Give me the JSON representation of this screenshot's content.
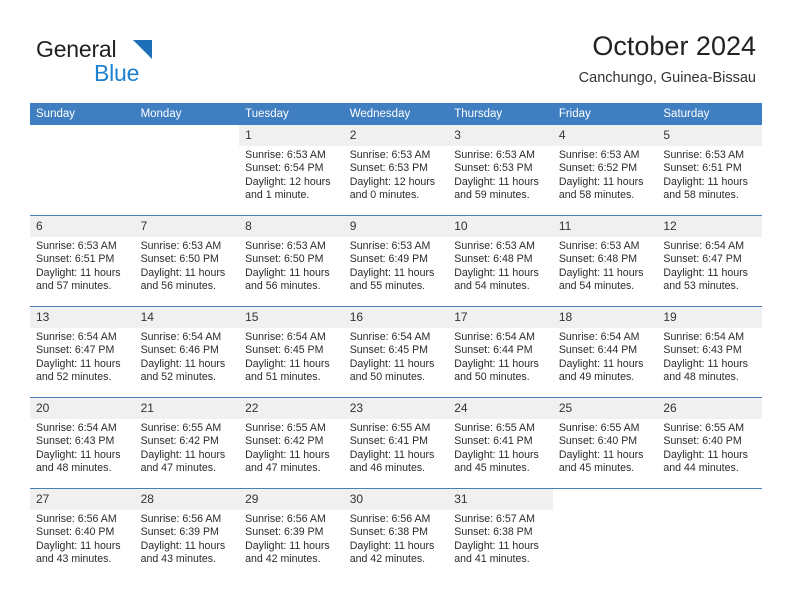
{
  "brand": {
    "line1": "General",
    "line2": "Blue",
    "triangle_color": "#1d6fb8",
    "line2_color": "#1d81d0"
  },
  "header": {
    "title": "October 2024",
    "subtitle": "Canchungo, Guinea-Bissau"
  },
  "theme": {
    "header_blue": "#3f7fc1",
    "daynum_band": "#f0f0f0",
    "grid_line": "#4a7fb5"
  },
  "weekdays": [
    "Sunday",
    "Monday",
    "Tuesday",
    "Wednesday",
    "Thursday",
    "Friday",
    "Saturday"
  ],
  "weeks": [
    [
      {
        "day": "",
        "sunrise": "",
        "sunset": "",
        "daylight1": "",
        "daylight2": "",
        "type": "blank"
      },
      {
        "day": "",
        "sunrise": "",
        "sunset": "",
        "daylight1": "",
        "daylight2": "",
        "type": "blank"
      },
      {
        "day": "1",
        "sunrise": "Sunrise: 6:53 AM",
        "sunset": "Sunset: 6:54 PM",
        "daylight1": "Daylight: 12 hours",
        "daylight2": "and 1 minute.",
        "type": "filled"
      },
      {
        "day": "2",
        "sunrise": "Sunrise: 6:53 AM",
        "sunset": "Sunset: 6:53 PM",
        "daylight1": "Daylight: 12 hours",
        "daylight2": "and 0 minutes.",
        "type": "filled"
      },
      {
        "day": "3",
        "sunrise": "Sunrise: 6:53 AM",
        "sunset": "Sunset: 6:53 PM",
        "daylight1": "Daylight: 11 hours",
        "daylight2": "and 59 minutes.",
        "type": "filled"
      },
      {
        "day": "4",
        "sunrise": "Sunrise: 6:53 AM",
        "sunset": "Sunset: 6:52 PM",
        "daylight1": "Daylight: 11 hours",
        "daylight2": "and 58 minutes.",
        "type": "filled"
      },
      {
        "day": "5",
        "sunrise": "Sunrise: 6:53 AM",
        "sunset": "Sunset: 6:51 PM",
        "daylight1": "Daylight: 11 hours",
        "daylight2": "and 58 minutes.",
        "type": "filled"
      }
    ],
    [
      {
        "day": "6",
        "sunrise": "Sunrise: 6:53 AM",
        "sunset": "Sunset: 6:51 PM",
        "daylight1": "Daylight: 11 hours",
        "daylight2": "and 57 minutes.",
        "type": "filled"
      },
      {
        "day": "7",
        "sunrise": "Sunrise: 6:53 AM",
        "sunset": "Sunset: 6:50 PM",
        "daylight1": "Daylight: 11 hours",
        "daylight2": "and 56 minutes.",
        "type": "filled"
      },
      {
        "day": "8",
        "sunrise": "Sunrise: 6:53 AM",
        "sunset": "Sunset: 6:50 PM",
        "daylight1": "Daylight: 11 hours",
        "daylight2": "and 56 minutes.",
        "type": "filled"
      },
      {
        "day": "9",
        "sunrise": "Sunrise: 6:53 AM",
        "sunset": "Sunset: 6:49 PM",
        "daylight1": "Daylight: 11 hours",
        "daylight2": "and 55 minutes.",
        "type": "filled"
      },
      {
        "day": "10",
        "sunrise": "Sunrise: 6:53 AM",
        "sunset": "Sunset: 6:48 PM",
        "daylight1": "Daylight: 11 hours",
        "daylight2": "and 54 minutes.",
        "type": "filled"
      },
      {
        "day": "11",
        "sunrise": "Sunrise: 6:53 AM",
        "sunset": "Sunset: 6:48 PM",
        "daylight1": "Daylight: 11 hours",
        "daylight2": "and 54 minutes.",
        "type": "filled"
      },
      {
        "day": "12",
        "sunrise": "Sunrise: 6:54 AM",
        "sunset": "Sunset: 6:47 PM",
        "daylight1": "Daylight: 11 hours",
        "daylight2": "and 53 minutes.",
        "type": "filled"
      }
    ],
    [
      {
        "day": "13",
        "sunrise": "Sunrise: 6:54 AM",
        "sunset": "Sunset: 6:47 PM",
        "daylight1": "Daylight: 11 hours",
        "daylight2": "and 52 minutes.",
        "type": "filled"
      },
      {
        "day": "14",
        "sunrise": "Sunrise: 6:54 AM",
        "sunset": "Sunset: 6:46 PM",
        "daylight1": "Daylight: 11 hours",
        "daylight2": "and 52 minutes.",
        "type": "filled"
      },
      {
        "day": "15",
        "sunrise": "Sunrise: 6:54 AM",
        "sunset": "Sunset: 6:45 PM",
        "daylight1": "Daylight: 11 hours",
        "daylight2": "and 51 minutes.",
        "type": "filled"
      },
      {
        "day": "16",
        "sunrise": "Sunrise: 6:54 AM",
        "sunset": "Sunset: 6:45 PM",
        "daylight1": "Daylight: 11 hours",
        "daylight2": "and 50 minutes.",
        "type": "filled"
      },
      {
        "day": "17",
        "sunrise": "Sunrise: 6:54 AM",
        "sunset": "Sunset: 6:44 PM",
        "daylight1": "Daylight: 11 hours",
        "daylight2": "and 50 minutes.",
        "type": "filled"
      },
      {
        "day": "18",
        "sunrise": "Sunrise: 6:54 AM",
        "sunset": "Sunset: 6:44 PM",
        "daylight1": "Daylight: 11 hours",
        "daylight2": "and 49 minutes.",
        "type": "filled"
      },
      {
        "day": "19",
        "sunrise": "Sunrise: 6:54 AM",
        "sunset": "Sunset: 6:43 PM",
        "daylight1": "Daylight: 11 hours",
        "daylight2": "and 48 minutes.",
        "type": "filled"
      }
    ],
    [
      {
        "day": "20",
        "sunrise": "Sunrise: 6:54 AM",
        "sunset": "Sunset: 6:43 PM",
        "daylight1": "Daylight: 11 hours",
        "daylight2": "and 48 minutes.",
        "type": "filled"
      },
      {
        "day": "21",
        "sunrise": "Sunrise: 6:55 AM",
        "sunset": "Sunset: 6:42 PM",
        "daylight1": "Daylight: 11 hours",
        "daylight2": "and 47 minutes.",
        "type": "filled"
      },
      {
        "day": "22",
        "sunrise": "Sunrise: 6:55 AM",
        "sunset": "Sunset: 6:42 PM",
        "daylight1": "Daylight: 11 hours",
        "daylight2": "and 47 minutes.",
        "type": "filled"
      },
      {
        "day": "23",
        "sunrise": "Sunrise: 6:55 AM",
        "sunset": "Sunset: 6:41 PM",
        "daylight1": "Daylight: 11 hours",
        "daylight2": "and 46 minutes.",
        "type": "filled"
      },
      {
        "day": "24",
        "sunrise": "Sunrise: 6:55 AM",
        "sunset": "Sunset: 6:41 PM",
        "daylight1": "Daylight: 11 hours",
        "daylight2": "and 45 minutes.",
        "type": "filled"
      },
      {
        "day": "25",
        "sunrise": "Sunrise: 6:55 AM",
        "sunset": "Sunset: 6:40 PM",
        "daylight1": "Daylight: 11 hours",
        "daylight2": "and 45 minutes.",
        "type": "filled"
      },
      {
        "day": "26",
        "sunrise": "Sunrise: 6:55 AM",
        "sunset": "Sunset: 6:40 PM",
        "daylight1": "Daylight: 11 hours",
        "daylight2": "and 44 minutes.",
        "type": "filled"
      }
    ],
    [
      {
        "day": "27",
        "sunrise": "Sunrise: 6:56 AM",
        "sunset": "Sunset: 6:40 PM",
        "daylight1": "Daylight: 11 hours",
        "daylight2": "and 43 minutes.",
        "type": "filled"
      },
      {
        "day": "28",
        "sunrise": "Sunrise: 6:56 AM",
        "sunset": "Sunset: 6:39 PM",
        "daylight1": "Daylight: 11 hours",
        "daylight2": "and 43 minutes.",
        "type": "filled"
      },
      {
        "day": "29",
        "sunrise": "Sunrise: 6:56 AM",
        "sunset": "Sunset: 6:39 PM",
        "daylight1": "Daylight: 11 hours",
        "daylight2": "and 42 minutes.",
        "type": "filled"
      },
      {
        "day": "30",
        "sunrise": "Sunrise: 6:56 AM",
        "sunset": "Sunset: 6:38 PM",
        "daylight1": "Daylight: 11 hours",
        "daylight2": "and 42 minutes.",
        "type": "filled"
      },
      {
        "day": "31",
        "sunrise": "Sunrise: 6:57 AM",
        "sunset": "Sunset: 6:38 PM",
        "daylight1": "Daylight: 11 hours",
        "daylight2": "and 41 minutes.",
        "type": "filled"
      },
      {
        "day": "",
        "sunrise": "",
        "sunset": "",
        "daylight1": "",
        "daylight2": "",
        "type": "blank"
      },
      {
        "day": "",
        "sunrise": "",
        "sunset": "",
        "daylight1": "",
        "daylight2": "",
        "type": "blank"
      }
    ]
  ]
}
